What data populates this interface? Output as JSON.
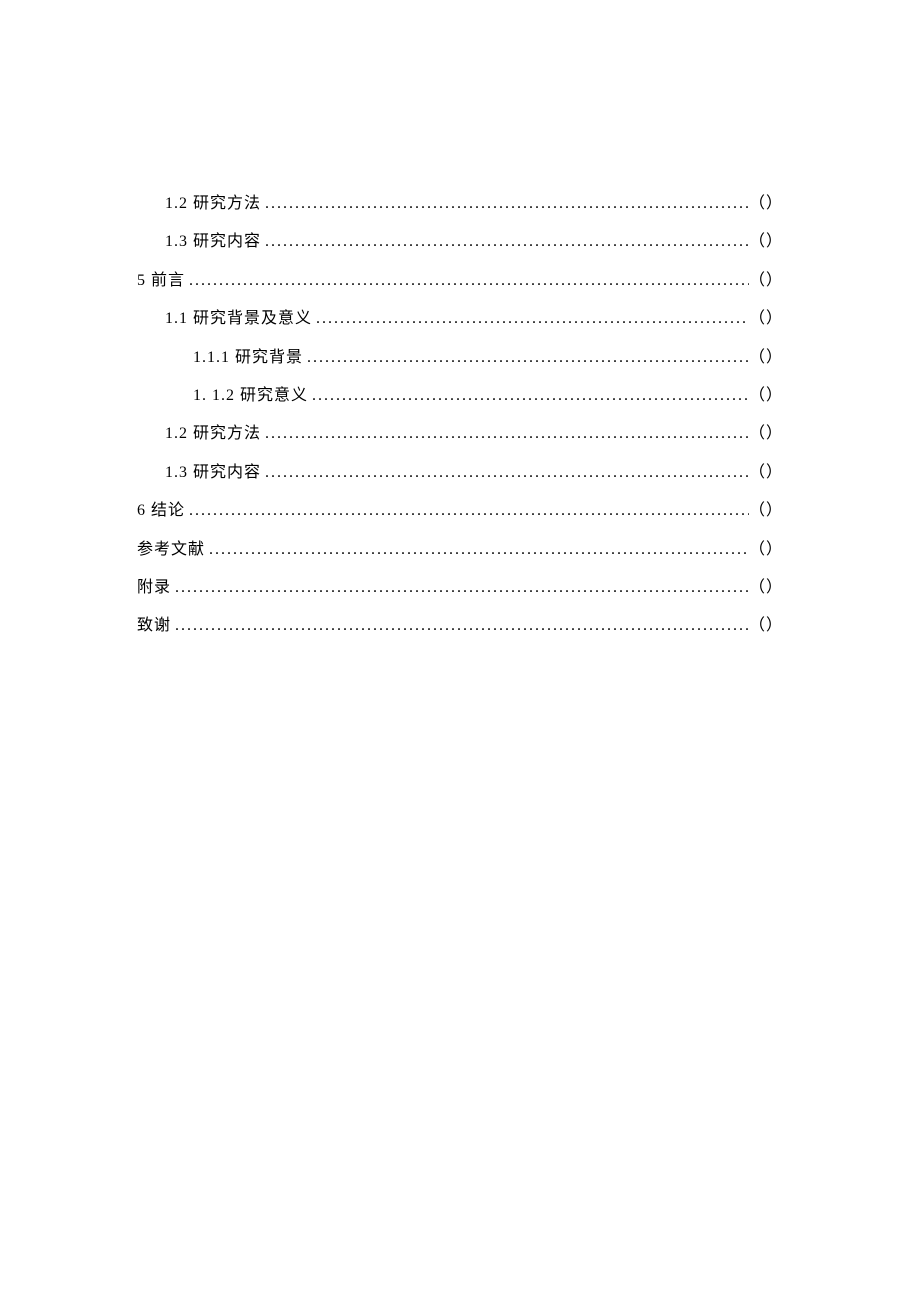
{
  "toc": [
    {
      "level": 1,
      "label": "1.2 研究方法",
      "page": "（）"
    },
    {
      "level": 1,
      "label": "1.3 研究内容",
      "page": "（）"
    },
    {
      "level": 0,
      "label": "5 前言",
      "page": "（）"
    },
    {
      "level": 1,
      "label": "1.1 研究背景及意义",
      "page": "（）"
    },
    {
      "level": 2,
      "label": "1.1.1 研究背景",
      "page": "（）"
    },
    {
      "level": 2,
      "label": "1. 1.2 研究意义",
      "page": "（）"
    },
    {
      "level": 1,
      "label": "1.2 研究方法",
      "page": "（）"
    },
    {
      "level": 1,
      "label": "1.3 研究内容",
      "page": "（）"
    },
    {
      "level": 0,
      "label": "6 结论",
      "page": "（）"
    },
    {
      "level": 0,
      "label": "参考文献",
      "page": "（）"
    },
    {
      "level": 0,
      "label": "附录",
      "page": "（）"
    },
    {
      "level": 0,
      "label": "致谢",
      "page": "（）"
    }
  ]
}
